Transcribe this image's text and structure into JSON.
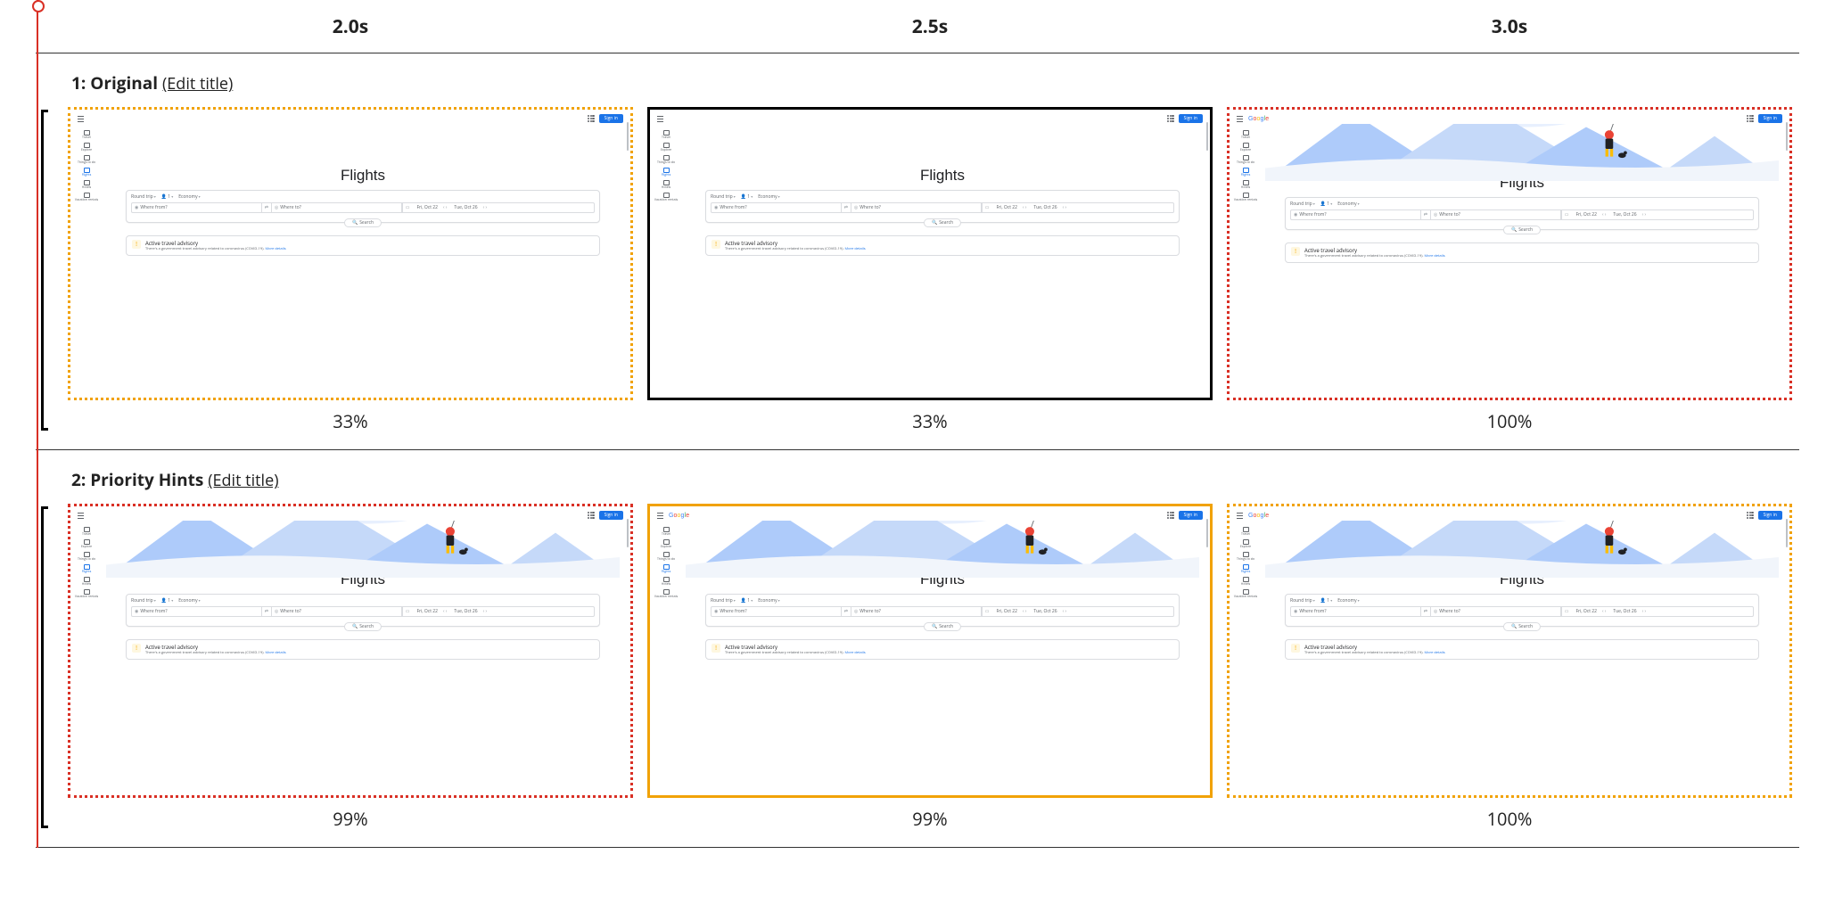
{
  "timeline": {
    "times": [
      "2.0s",
      "2.5s",
      "3.0s"
    ]
  },
  "rows": [
    {
      "index": "1",
      "name": "Original",
      "edit_label": "(Edit title)",
      "frames": [
        {
          "border": "dotted-orange",
          "pct": "33%",
          "hero": false,
          "logo": false
        },
        {
          "border": "solid-black",
          "pct": "33%",
          "hero": false,
          "logo": false
        },
        {
          "border": "dotted-red",
          "pct": "100%",
          "hero": true,
          "logo": true
        }
      ]
    },
    {
      "index": "2",
      "name": "Priority Hints",
      "edit_label": "(Edit title)",
      "frames": [
        {
          "border": "dotted-red",
          "pct": "99%",
          "hero": true,
          "logo": false
        },
        {
          "border": "solid-orange",
          "pct": "99%",
          "hero": true,
          "logo": true
        },
        {
          "border": "dotted-orange",
          "pct": "100%",
          "hero": true,
          "logo": true
        }
      ]
    }
  ],
  "flights": {
    "headline": "Flights",
    "signin": "Sign in",
    "logo": "Google",
    "nav": [
      {
        "label": "Travel",
        "active": false
      },
      {
        "label": "Explore",
        "active": false
      },
      {
        "label": "Things to do",
        "active": false
      },
      {
        "label": "Flights",
        "active": true
      },
      {
        "label": "Hotels",
        "active": false
      },
      {
        "label": "Vacation rentals",
        "active": false
      }
    ],
    "chips": {
      "trip": "Round trip",
      "pax": "1",
      "class": "Economy"
    },
    "fields": {
      "origin_placeholder": "Where from?",
      "dest_placeholder": "Where to?",
      "date1": "Fri, Oct 22",
      "date2": "Tue, Oct 26"
    },
    "search_label": "Search",
    "advisory": {
      "title": "Active travel advisory",
      "sub": "There's a government travel advisory related to coronavirus (COVID-19).",
      "link": "More details"
    }
  }
}
